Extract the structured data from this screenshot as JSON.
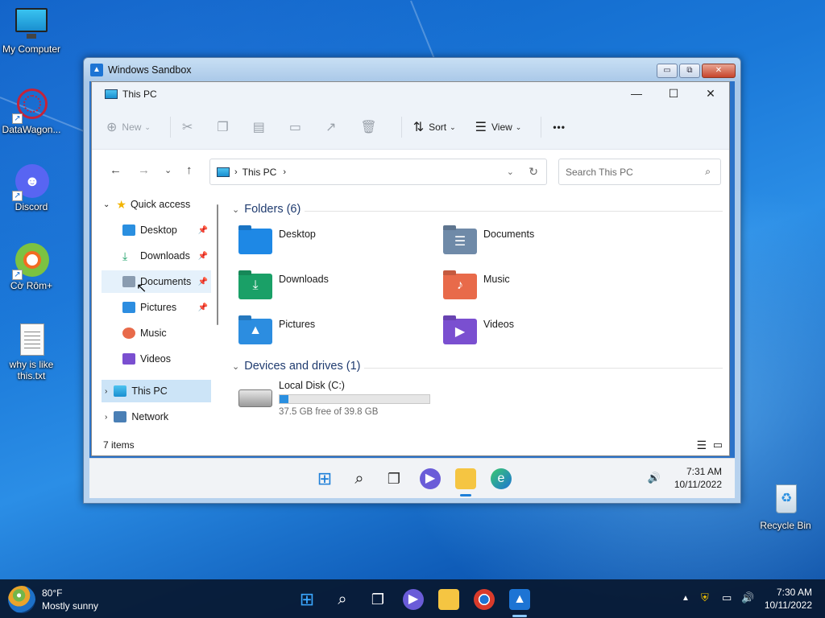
{
  "desktop": {
    "icons": [
      {
        "label": "My Computer",
        "icon": "monitor-icon"
      },
      {
        "label": "DataWagon...",
        "icon": "datawagon-icon"
      },
      {
        "label": "Discord",
        "icon": "discord-icon"
      },
      {
        "label": "Cờ Rôm+",
        "icon": "coccoc-icon"
      },
      {
        "label": "why is like this.txt",
        "icon": "text-file-icon"
      },
      {
        "label": "Recycle Bin",
        "icon": "recycle-bin-icon"
      }
    ]
  },
  "sandbox": {
    "title": "Windows Sandbox",
    "controls": {
      "minimize": "▭",
      "restore": "⧉",
      "close": "✕"
    }
  },
  "explorer": {
    "title": "This PC",
    "window_controls": {
      "minimize": "—",
      "maximize": "☐",
      "close": "✕"
    },
    "toolbar": {
      "new_label": "New",
      "sort_label": "Sort",
      "view_label": "View",
      "more_label": "•••"
    },
    "address": {
      "location": "This PC"
    },
    "search": {
      "placeholder": "Search This PC"
    },
    "nav": {
      "quick_access": "Quick access",
      "items": [
        {
          "label": "Desktop",
          "pinned": true
        },
        {
          "label": "Downloads",
          "pinned": true
        },
        {
          "label": "Documents",
          "pinned": true
        },
        {
          "label": "Pictures",
          "pinned": true
        },
        {
          "label": "Music",
          "pinned": false
        },
        {
          "label": "Videos",
          "pinned": false
        }
      ],
      "this_pc": "This PC",
      "network": "Network"
    },
    "folders_header": "Folders (6)",
    "folders": [
      {
        "label": "Desktop",
        "color": "#1e88e5"
      },
      {
        "label": "Documents",
        "color": "#6f8aa8"
      },
      {
        "label": "Downloads",
        "color": "#1aa067"
      },
      {
        "label": "Music",
        "color": "#e86a4a"
      },
      {
        "label": "Pictures",
        "color": "#2c8de0"
      },
      {
        "label": "Videos",
        "color": "#7a4fd0"
      }
    ],
    "drives_header": "Devices and drives (1)",
    "drive": {
      "name": "Local Disk (C:)",
      "free_text": "37.5 GB free of 39.8 GB",
      "used_fraction": 0.058
    },
    "status": {
      "items": "7 items"
    }
  },
  "inner_taskbar": {
    "time": "7:31 AM",
    "date": "10/11/2022"
  },
  "taskbar": {
    "weather_temp": "80°F",
    "weather_desc": "Mostly sunny",
    "time": "7:30 AM",
    "date": "10/11/2022"
  }
}
